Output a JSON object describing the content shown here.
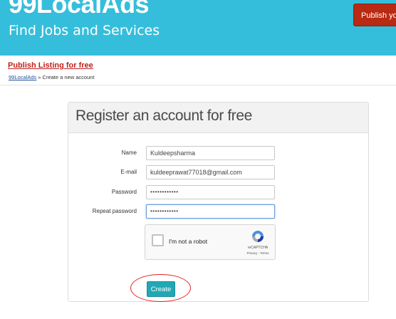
{
  "header": {
    "logo": "99LocalAds",
    "tagline": "Find Jobs and Services",
    "publish_button": "Publish your a"
  },
  "publish_listing_link": "Publish Listing for free",
  "breadcrumb": {
    "home": "99LocalAds",
    "separator": " » ",
    "current": "Create a new account"
  },
  "form": {
    "title": "Register an account for free",
    "fields": [
      {
        "label": "Name",
        "value": "Kuldeepsharma"
      },
      {
        "label": "E-mail",
        "value": "kuldeeprawat77018@gmail.com"
      },
      {
        "label": "Password",
        "value": "••••••••••••"
      },
      {
        "label": "Repeat password",
        "value": "••••••••••••"
      }
    ],
    "captcha": {
      "label": "I'm not a robot",
      "brand": "reCAPTCHA",
      "links": "Privacy - Terms"
    },
    "submit": "Create"
  },
  "colors": {
    "header_bg": "#35bedb",
    "publish_button": "#b82a12",
    "create_button": "#22a8b5",
    "highlight_circle": "#e32020"
  }
}
